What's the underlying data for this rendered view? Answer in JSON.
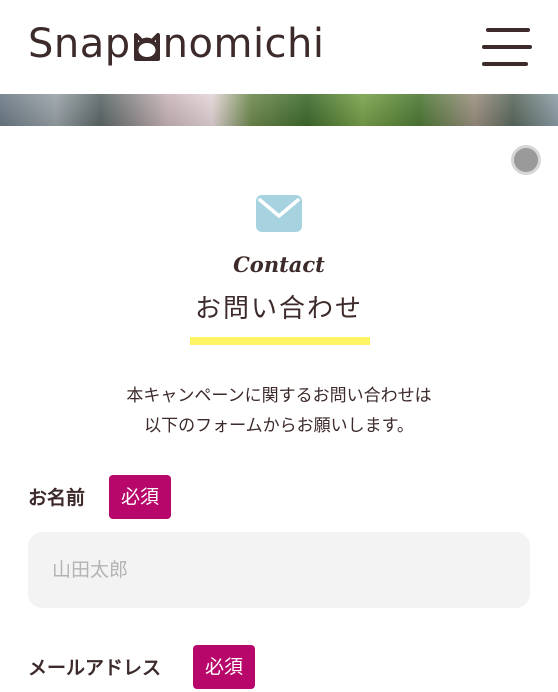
{
  "header": {
    "logo_text": "Snapᵝnomichi",
    "menu_icon": "hamburger-icon"
  },
  "contact": {
    "icon": "mail-icon",
    "title_en": "Contact",
    "title_ja": "お問い合わせ",
    "intro_line1": "本キャンペーンに関するお問い合わせは",
    "intro_line2": "以下のフォームからお願いします。"
  },
  "form": {
    "name_label": "お名前",
    "name_required": "必須",
    "name_placeholder": "山田太郎",
    "email_label": "メールアドレス",
    "email_required": "必須"
  },
  "colors": {
    "text": "#3d2a2a",
    "accent_badge": "#b8076a",
    "underline": "#fff463",
    "mail_icon": "#a7d3e0",
    "input_bg": "#f3f3f3"
  }
}
